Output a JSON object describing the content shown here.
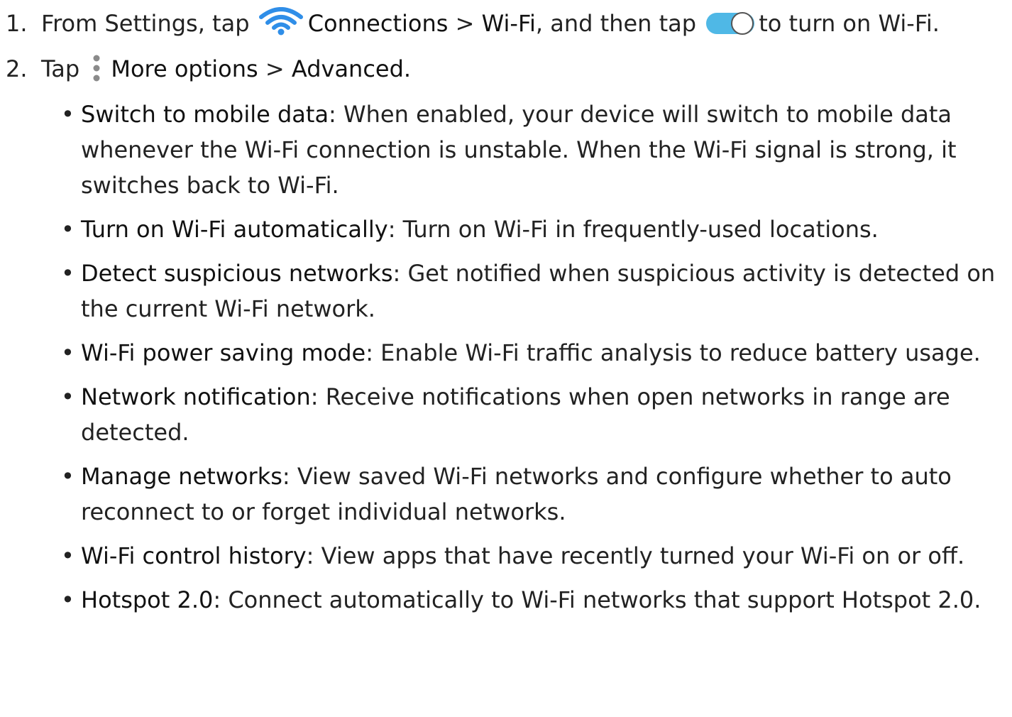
{
  "step1": {
    "num": "1.",
    "prefix": "From Settings, tap",
    "connections": "Connections",
    "sep": " > ",
    "wifi": "Wi-Fi",
    "middle": ", and then tap",
    "suffix": "to turn on Wi-Fi."
  },
  "step2": {
    "num": "2.",
    "prefix": "Tap",
    "more_options": "More options",
    "sep": " > ",
    "advanced": "Advanced."
  },
  "bullets": [
    {
      "term": "Switch to mobile data",
      "desc": ": When enabled, your device will switch to mobile data whenever the Wi-Fi connection is unstable. When the Wi-Fi signal is strong, it switches back to Wi-Fi."
    },
    {
      "term": "Turn on Wi-Fi automatically",
      "desc": ": Turn on Wi-Fi in frequently-used locations."
    },
    {
      "term": "Detect suspicious networks",
      "desc": ": Get notified when suspicious activity is detected on the current Wi-Fi network."
    },
    {
      "term": "Wi-Fi power saving mode",
      "desc": ": Enable Wi-Fi traffic analysis to reduce battery usage."
    },
    {
      "term": "Network notification",
      "desc": ": Receive notifications when open networks in range are detected."
    },
    {
      "term": "Manage networks",
      "desc": ": View saved Wi-Fi networks and configure whether to auto reconnect to or forget individual networks."
    },
    {
      "term": "Wi-Fi control history",
      "desc": ": View apps that have recently turned your Wi-Fi on or off."
    },
    {
      "term": "Hotspot 2.0",
      "desc": ": Connect automatically to Wi-Fi networks that support Hotspot 2.0."
    }
  ],
  "bullet_char": "•",
  "icons": {
    "wifi": "wifi-icon",
    "toggle": "toggle-icon",
    "more": "more-options-icon"
  },
  "colors": {
    "wifi": "#2f8ee8",
    "toggle_track": "#4fb8e6",
    "more_dots": "#8a8a8a"
  }
}
